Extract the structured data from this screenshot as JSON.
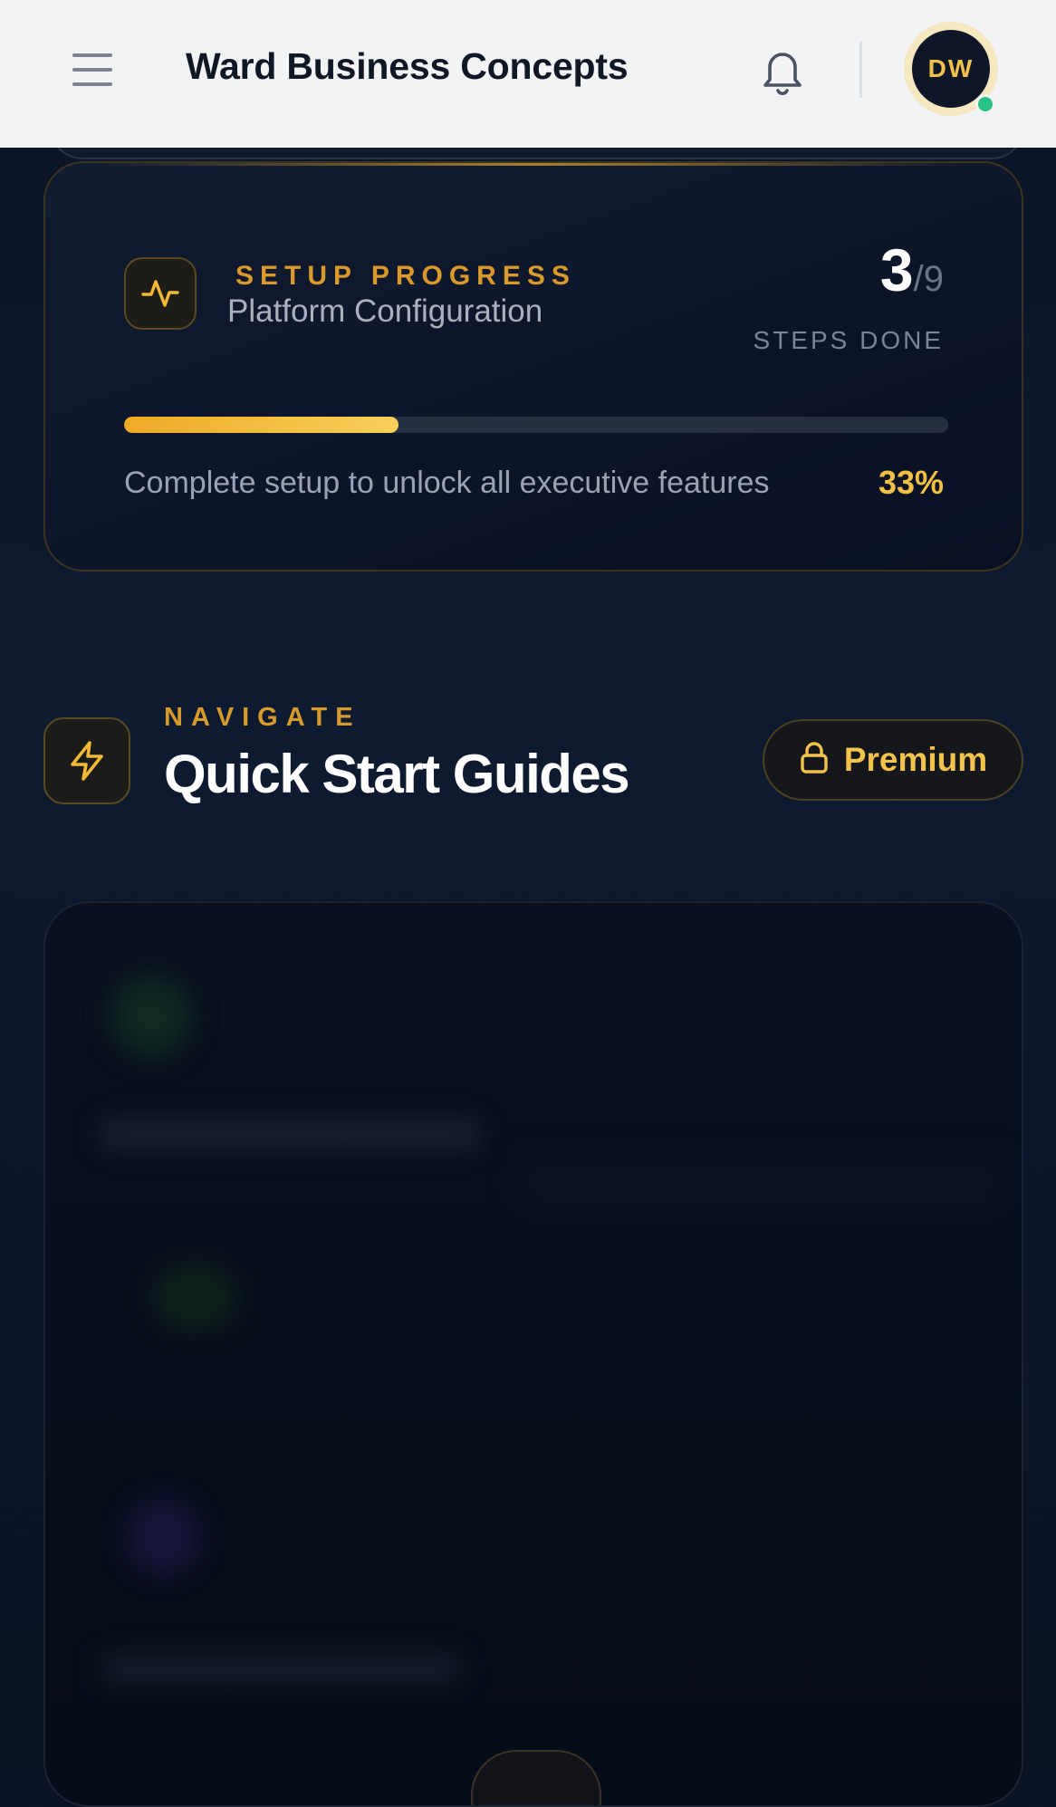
{
  "header": {
    "title": "Ward Business Concepts",
    "avatar_initials": "DW",
    "online_status_color": "#27c281",
    "icons": [
      "menu-icon",
      "bell-icon"
    ]
  },
  "setup": {
    "eyebrow": "SETUP PROGRESS",
    "subtitle": "Platform Configuration",
    "steps_done": "3",
    "steps_total": "/9",
    "steps_label": "STEPS DONE",
    "progress_fraction": 0.333,
    "hint": "Complete setup to unlock all executive features",
    "percent": "33%",
    "icon": "activity-pulse-icon"
  },
  "navigate": {
    "eyebrow": "NAVIGATE",
    "title": "Quick Start Guides",
    "premium_label": "Premium",
    "icon": "lightning-bolt-icon",
    "premium_icon": "lock-icon"
  },
  "colors": {
    "accent_gold": "#f3c34b",
    "accent_orange": "#d99a2b",
    "background": "#0b1426"
  }
}
